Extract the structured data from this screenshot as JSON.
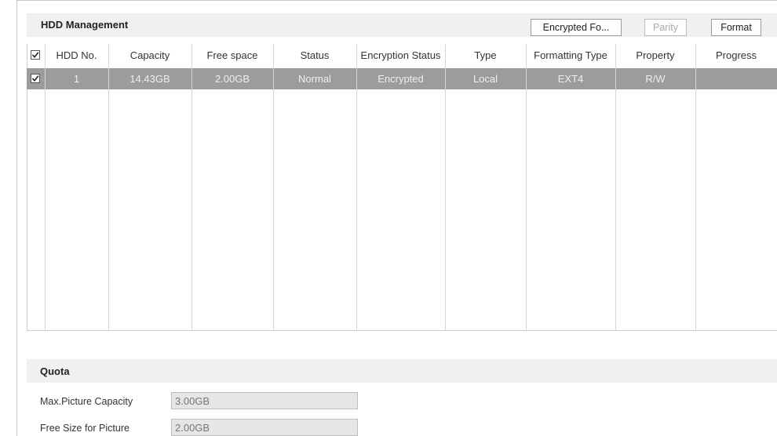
{
  "hdd": {
    "title": "HDD Management",
    "buttons": {
      "encrypted_format": "Encrypted Fo...",
      "parity": "Parity",
      "format": "Format"
    },
    "columns": [
      "HDD No.",
      "Capacity",
      "Free space",
      "Status",
      "Encryption Status",
      "Type",
      "Formatting Type",
      "Property",
      "Progress"
    ],
    "header_checked": true,
    "rows": [
      {
        "checked": true,
        "hdd_no": "1",
        "capacity": "14.43GB",
        "free_space": "2.00GB",
        "status": "Normal",
        "encryption_status": "Encrypted",
        "type": "Local",
        "formatting_type": "EXT4",
        "property": "R/W",
        "progress": ""
      }
    ]
  },
  "quota": {
    "title": "Quota",
    "max_picture_capacity_label": "Max.Picture Capacity",
    "max_picture_capacity_value": "3.00GB",
    "free_size_for_picture_label": "Free Size for Picture",
    "free_size_for_picture_value": "2.00GB"
  },
  "colors": {
    "selected_row": "#9c9c9c",
    "section_header": "#f0f0f0",
    "readonly_field": "#e6e6e6"
  }
}
